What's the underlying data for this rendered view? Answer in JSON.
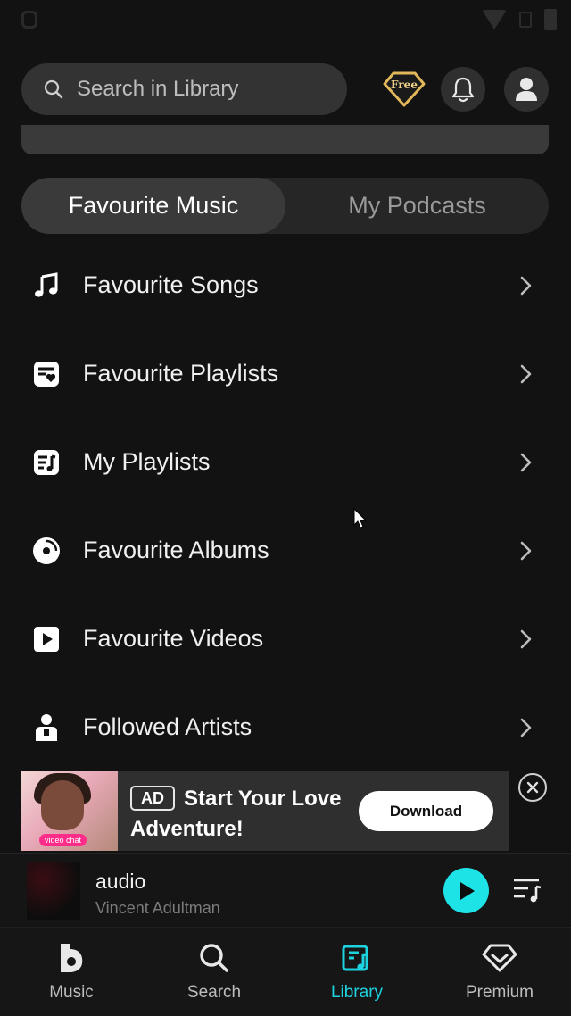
{
  "search": {
    "placeholder": "Search in Library"
  },
  "header": {
    "free_badge": "Free"
  },
  "tabs": [
    {
      "label": "Favourite Music",
      "active": true
    },
    {
      "label": "My Podcasts",
      "active": false
    }
  ],
  "library_items": [
    {
      "label": "Favourite Songs",
      "icon": "music-note-icon"
    },
    {
      "label": "Favourite Playlists",
      "icon": "playlist-heart-icon"
    },
    {
      "label": "My Playlists",
      "icon": "playlist-icon"
    },
    {
      "label": "Favourite Albums",
      "icon": "album-icon"
    },
    {
      "label": "Favourite Videos",
      "icon": "video-icon"
    },
    {
      "label": "Followed Artists",
      "icon": "artist-icon"
    }
  ],
  "ad": {
    "badge": "AD",
    "title": "Start Your Love Adventure!",
    "button": "Download",
    "thumb_tag": "video chat"
  },
  "player": {
    "title": "audio",
    "artist": "Vincent Adultman"
  },
  "nav": [
    {
      "label": "Music",
      "icon": "boomplay-logo-icon",
      "active": false
    },
    {
      "label": "Search",
      "icon": "search-icon",
      "active": false
    },
    {
      "label": "Library",
      "icon": "library-icon",
      "active": true
    },
    {
      "label": "Premium",
      "icon": "diamond-icon",
      "active": false
    }
  ],
  "colors": {
    "accent": "#1ee3e6",
    "background": "#121212",
    "gold": "#e2b85a"
  }
}
